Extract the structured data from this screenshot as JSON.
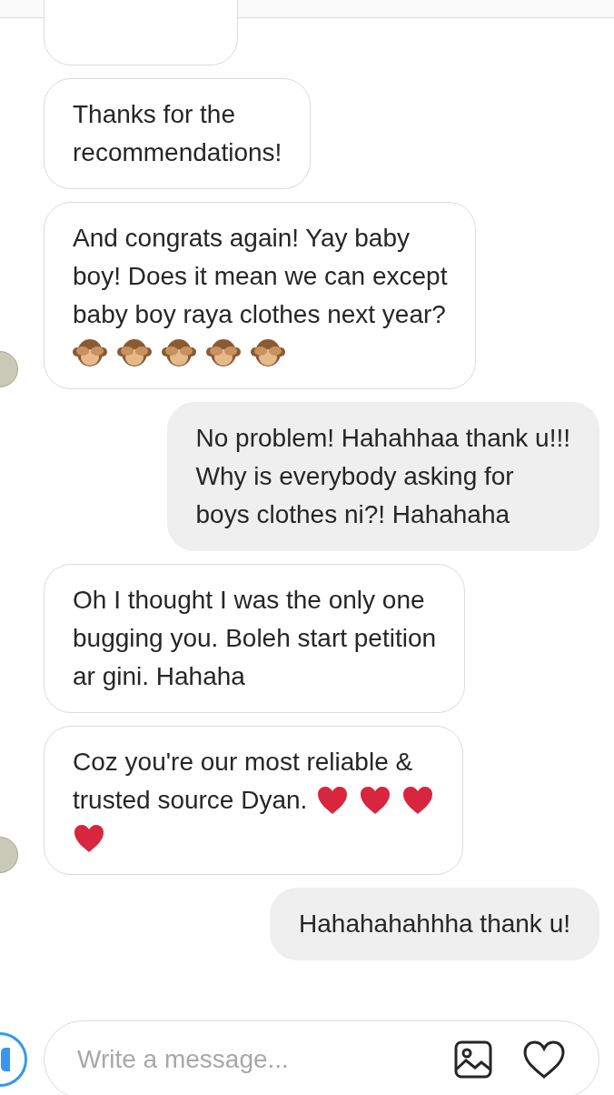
{
  "messages": [
    {
      "kind": "incoming",
      "avatar": false,
      "cut": true
    },
    {
      "kind": "incoming",
      "avatar": false,
      "lines": [
        {
          "text": "Thanks for the"
        },
        {
          "text": "recommendations!"
        }
      ]
    },
    {
      "kind": "incoming",
      "avatar": true,
      "lines": [
        {
          "text": "And congrats again! Yay baby"
        },
        {
          "text": "boy! Does it mean we can except"
        },
        {
          "text": "baby boy raya clothes next year?"
        },
        {
          "emojis": [
            {
              "kind": "monkey"
            },
            {
              "kind": "monkey"
            },
            {
              "kind": "monkey"
            },
            {
              "kind": "monkey"
            },
            {
              "kind": "monkey"
            }
          ]
        }
      ]
    },
    {
      "kind": "outgoing",
      "avatar": false,
      "lines": [
        {
          "text": "No problem! Hahahhaa thank u!!!"
        },
        {
          "text": "Why is everybody asking for"
        },
        {
          "text": "boys clothes ni?! Hahahaha"
        }
      ]
    },
    {
      "kind": "incoming",
      "avatar": false,
      "lines": [
        {
          "text": "Oh I thought I was the only one"
        },
        {
          "text": "bugging you. Boleh start petition"
        },
        {
          "text": "ar gini. Hahaha"
        }
      ]
    },
    {
      "kind": "incoming",
      "avatar": true,
      "lines": [
        {
          "text": "Coz you're our most reliable &"
        },
        {
          "text": "trusted source Dyan.",
          "emojis": [
            {
              "kind": "heart"
            },
            {
              "kind": "heart"
            },
            {
              "kind": "heart"
            }
          ]
        },
        {
          "emojis": [
            {
              "kind": "heart"
            }
          ]
        }
      ]
    },
    {
      "kind": "outgoing",
      "avatar": false,
      "lines": [
        {
          "text": "Hahahahahhha thank u!"
        }
      ]
    }
  ],
  "composer": {
    "placeholder": "Write a message..."
  }
}
